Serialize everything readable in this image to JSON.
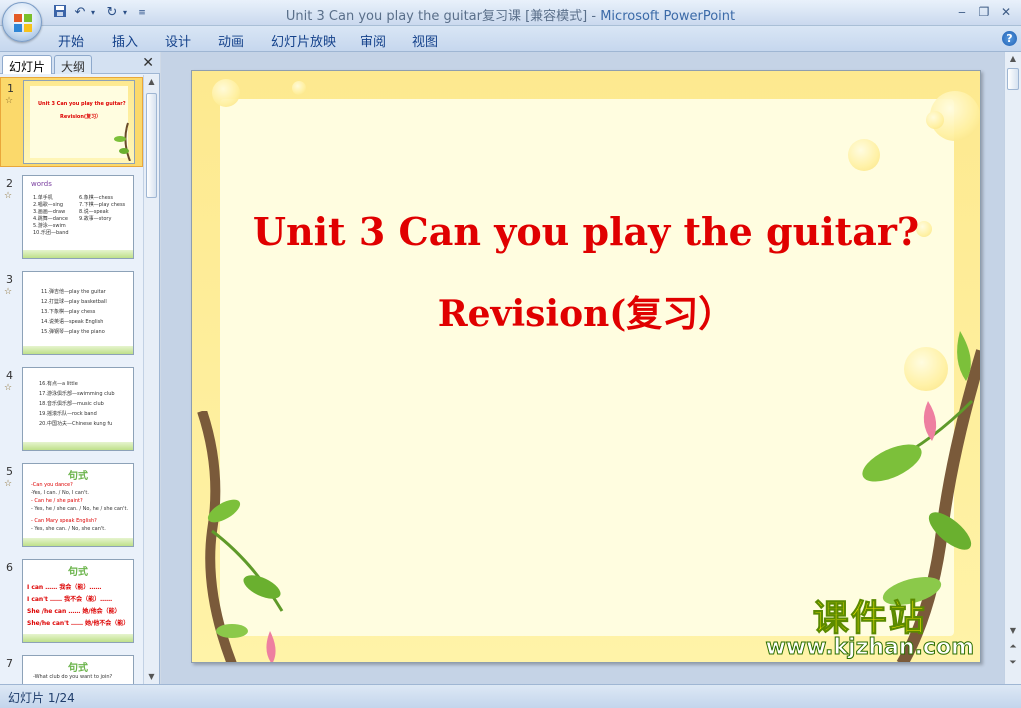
{
  "window": {
    "title": "Unit 3 Can you play the guitar复习课 [兼容模式]",
    "app_name": "Microsoft PowerPoint",
    "separator": " - "
  },
  "ribbon": {
    "tabs": [
      "开始",
      "插入",
      "设计",
      "动画",
      "幻灯片放映",
      "审阅",
      "视图"
    ]
  },
  "panel": {
    "tab_slides": "幻灯片",
    "tab_outline": "大纲"
  },
  "thumbnails": [
    {
      "num": "1",
      "lines": [
        "Unit 3 Can you play the guitar?",
        "Revision(复习）"
      ]
    },
    {
      "num": "2",
      "lines": [
        "words",
        "1.单手机",
        "2.唱歌—sing",
        "3.画画—draw",
        "4.跳舞—dance",
        "5.游泳—swim",
        "6.象棋—chess",
        "7.下棋—play chess",
        "8.说—speak",
        "9.故事—story",
        "10.乐团—band"
      ]
    },
    {
      "num": "3",
      "lines": [
        "11.弹吉他—play the guitar",
        "12.打篮球—play basketball",
        "13.下象棋—play chess",
        "14.说英语—speak English",
        "15.弹钢琴—play the piano"
      ]
    },
    {
      "num": "4",
      "lines": [
        "16.有点—a little",
        "17.游泳俱乐部—swimming club",
        "18.音乐俱乐部—music club",
        "19.摇滚乐队—rock band",
        "20.中国功夫—Chinese kung fu"
      ]
    },
    {
      "num": "5",
      "title": "句式",
      "lines": [
        "-Can you dance?",
        "-Yes, I can. / No, I can't.",
        "- Can he / she paint?",
        "- Yes, he / she can. / No, he / she can't.",
        "- Can Mary speak English?",
        "- Yes, she can. / No, she can't."
      ]
    },
    {
      "num": "6",
      "title": "句式",
      "lines": [
        "I can ……    我会（能）……",
        "I can't ……   我不会（能）……",
        "She /he can …… 她/他会（能）",
        "She/he can't …… 她/他不会（能）"
      ]
    },
    {
      "num": "7",
      "title": "句式",
      "lines": [
        "-What club do you want to join?"
      ]
    }
  ],
  "slide": {
    "title": "Unit 3 Can you play the guitar?",
    "subtitle": "Revision(复习）",
    "watermark_cn": "课件站",
    "watermark_url": "www.kjzhan.com"
  },
  "status": {
    "slide_counter": "幻灯片 1/24"
  },
  "colors": {
    "title_red": "#e00000",
    "selection": "#fbd96b"
  }
}
